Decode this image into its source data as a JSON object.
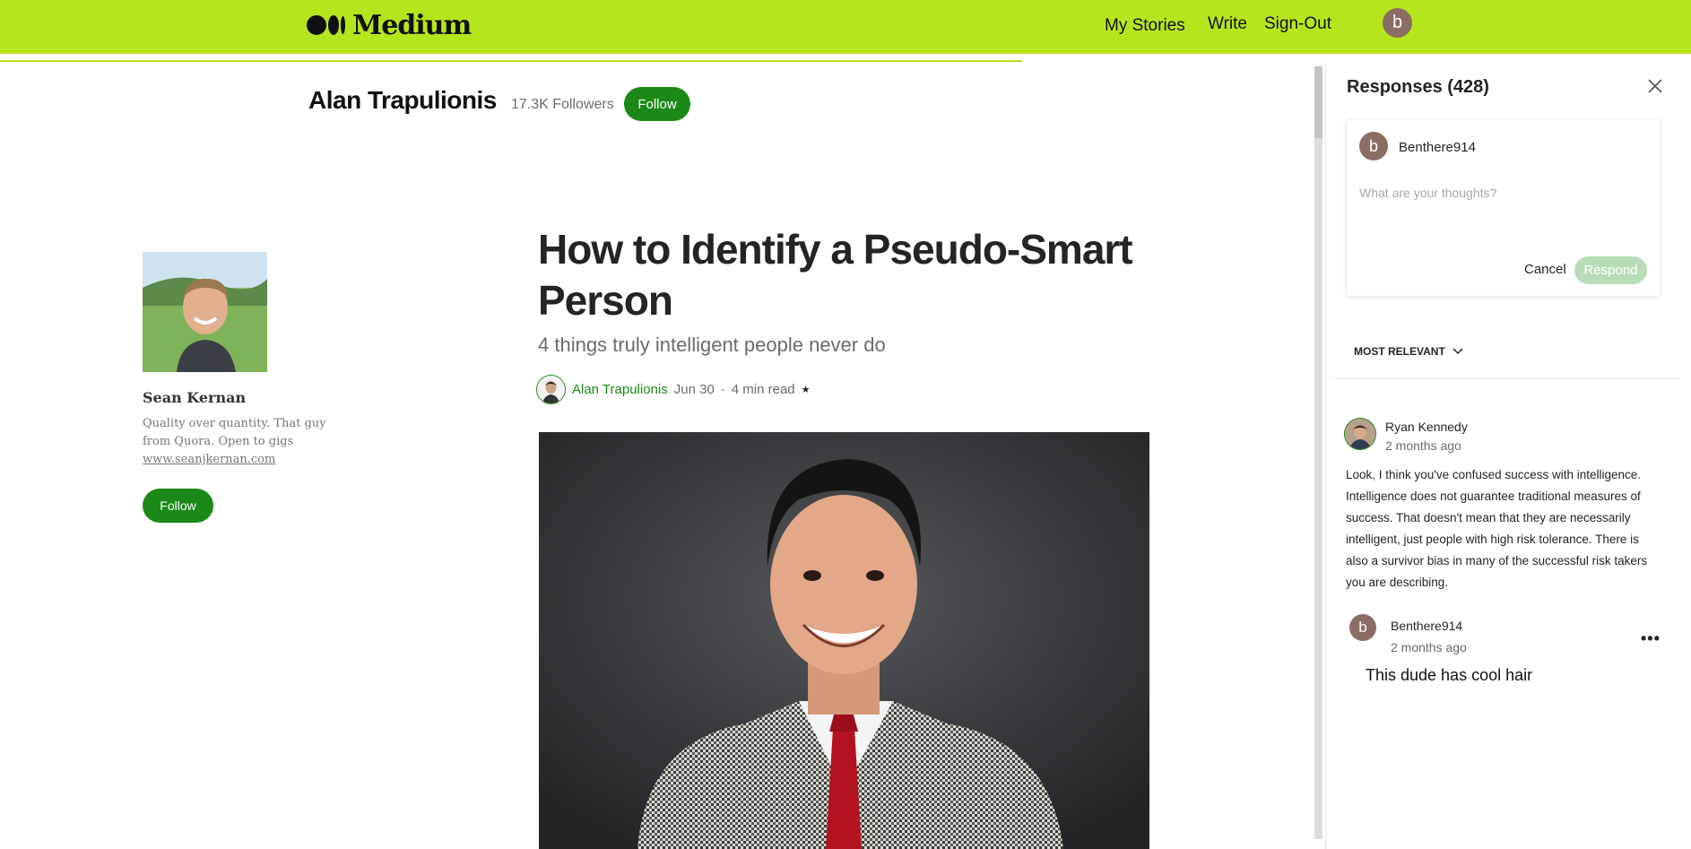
{
  "nav": {
    "logo_text": "Medium",
    "my_stories": "My Stories",
    "write": "Write",
    "sign_out": "Sign-Out",
    "avatar_letter": "b"
  },
  "author_strip": {
    "name": "Alan Trapulionis",
    "followers": "17.3K Followers",
    "follow_label": "Follow"
  },
  "profile": {
    "name": "Sean Kernan",
    "bio": "Quality over quantity. That guy from Quora. Open to gigs",
    "link": "www.seanjkernan.com",
    "follow_label": "Follow"
  },
  "article": {
    "title": "How to Identify a Pseudo-Smart Person",
    "subtitle": "4 things truly intelligent people never do",
    "author": "Alan Trapulionis",
    "date": "Jun 30",
    "separator": "·",
    "read_time": "4 min read",
    "star": "★"
  },
  "responses": {
    "title": "Responses (428)",
    "composer": {
      "avatar_letter": "b",
      "user": "Benthere914",
      "placeholder": "What are your thoughts?",
      "cancel": "Cancel",
      "respond": "Respond"
    },
    "sort_label": "MOST RELEVANT",
    "comments": [
      {
        "user": "Ryan Kennedy",
        "time": "2 months ago",
        "text": "Look, I think you've confused success with intelligence. Intelligence does not guarantee traditional measures of success. That doesn't mean that they are necessarily intelligent, just people with high risk tolerance. There is also a survivor bias in many of the successful risk takers you are describing."
      },
      {
        "avatar_letter": "b",
        "user": "Benthere914",
        "time": "2 months ago",
        "more": "•••",
        "text": "This dude has cool hair"
      }
    ]
  },
  "colors": {
    "topbar": "#b5e61d",
    "brand_green": "#1a8917",
    "respond_disabled": "#b9dcb8",
    "avatar_brown": "#8a6e64"
  },
  "icons": [
    "medium-logo-icon",
    "close-icon",
    "chevron-down-icon",
    "star-icon",
    "more-icon"
  ]
}
